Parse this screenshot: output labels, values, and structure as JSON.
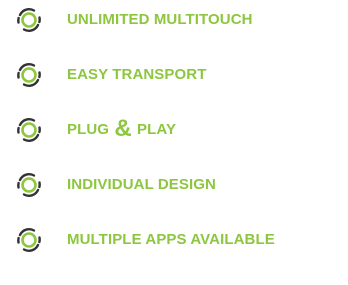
{
  "colors": {
    "accent_green": "#8dc63f",
    "icon_dark": "#333333"
  },
  "features": [
    {
      "icon": "circle-arrows-icon",
      "label": "UNLIMITED MULTITOUCH"
    },
    {
      "icon": "circle-arrows-icon",
      "label": "EASY TRANSPORT"
    },
    {
      "icon": "circle-arrows-icon",
      "label_prefix": "PLUG ",
      "label_amp": "&",
      "label_suffix": " PLAY"
    },
    {
      "icon": "circle-arrows-icon",
      "label": "INDIVIDUAL DESIGN"
    },
    {
      "icon": "circle-arrows-icon",
      "label": "MULTIPLE APPS AVAILABLE"
    }
  ]
}
